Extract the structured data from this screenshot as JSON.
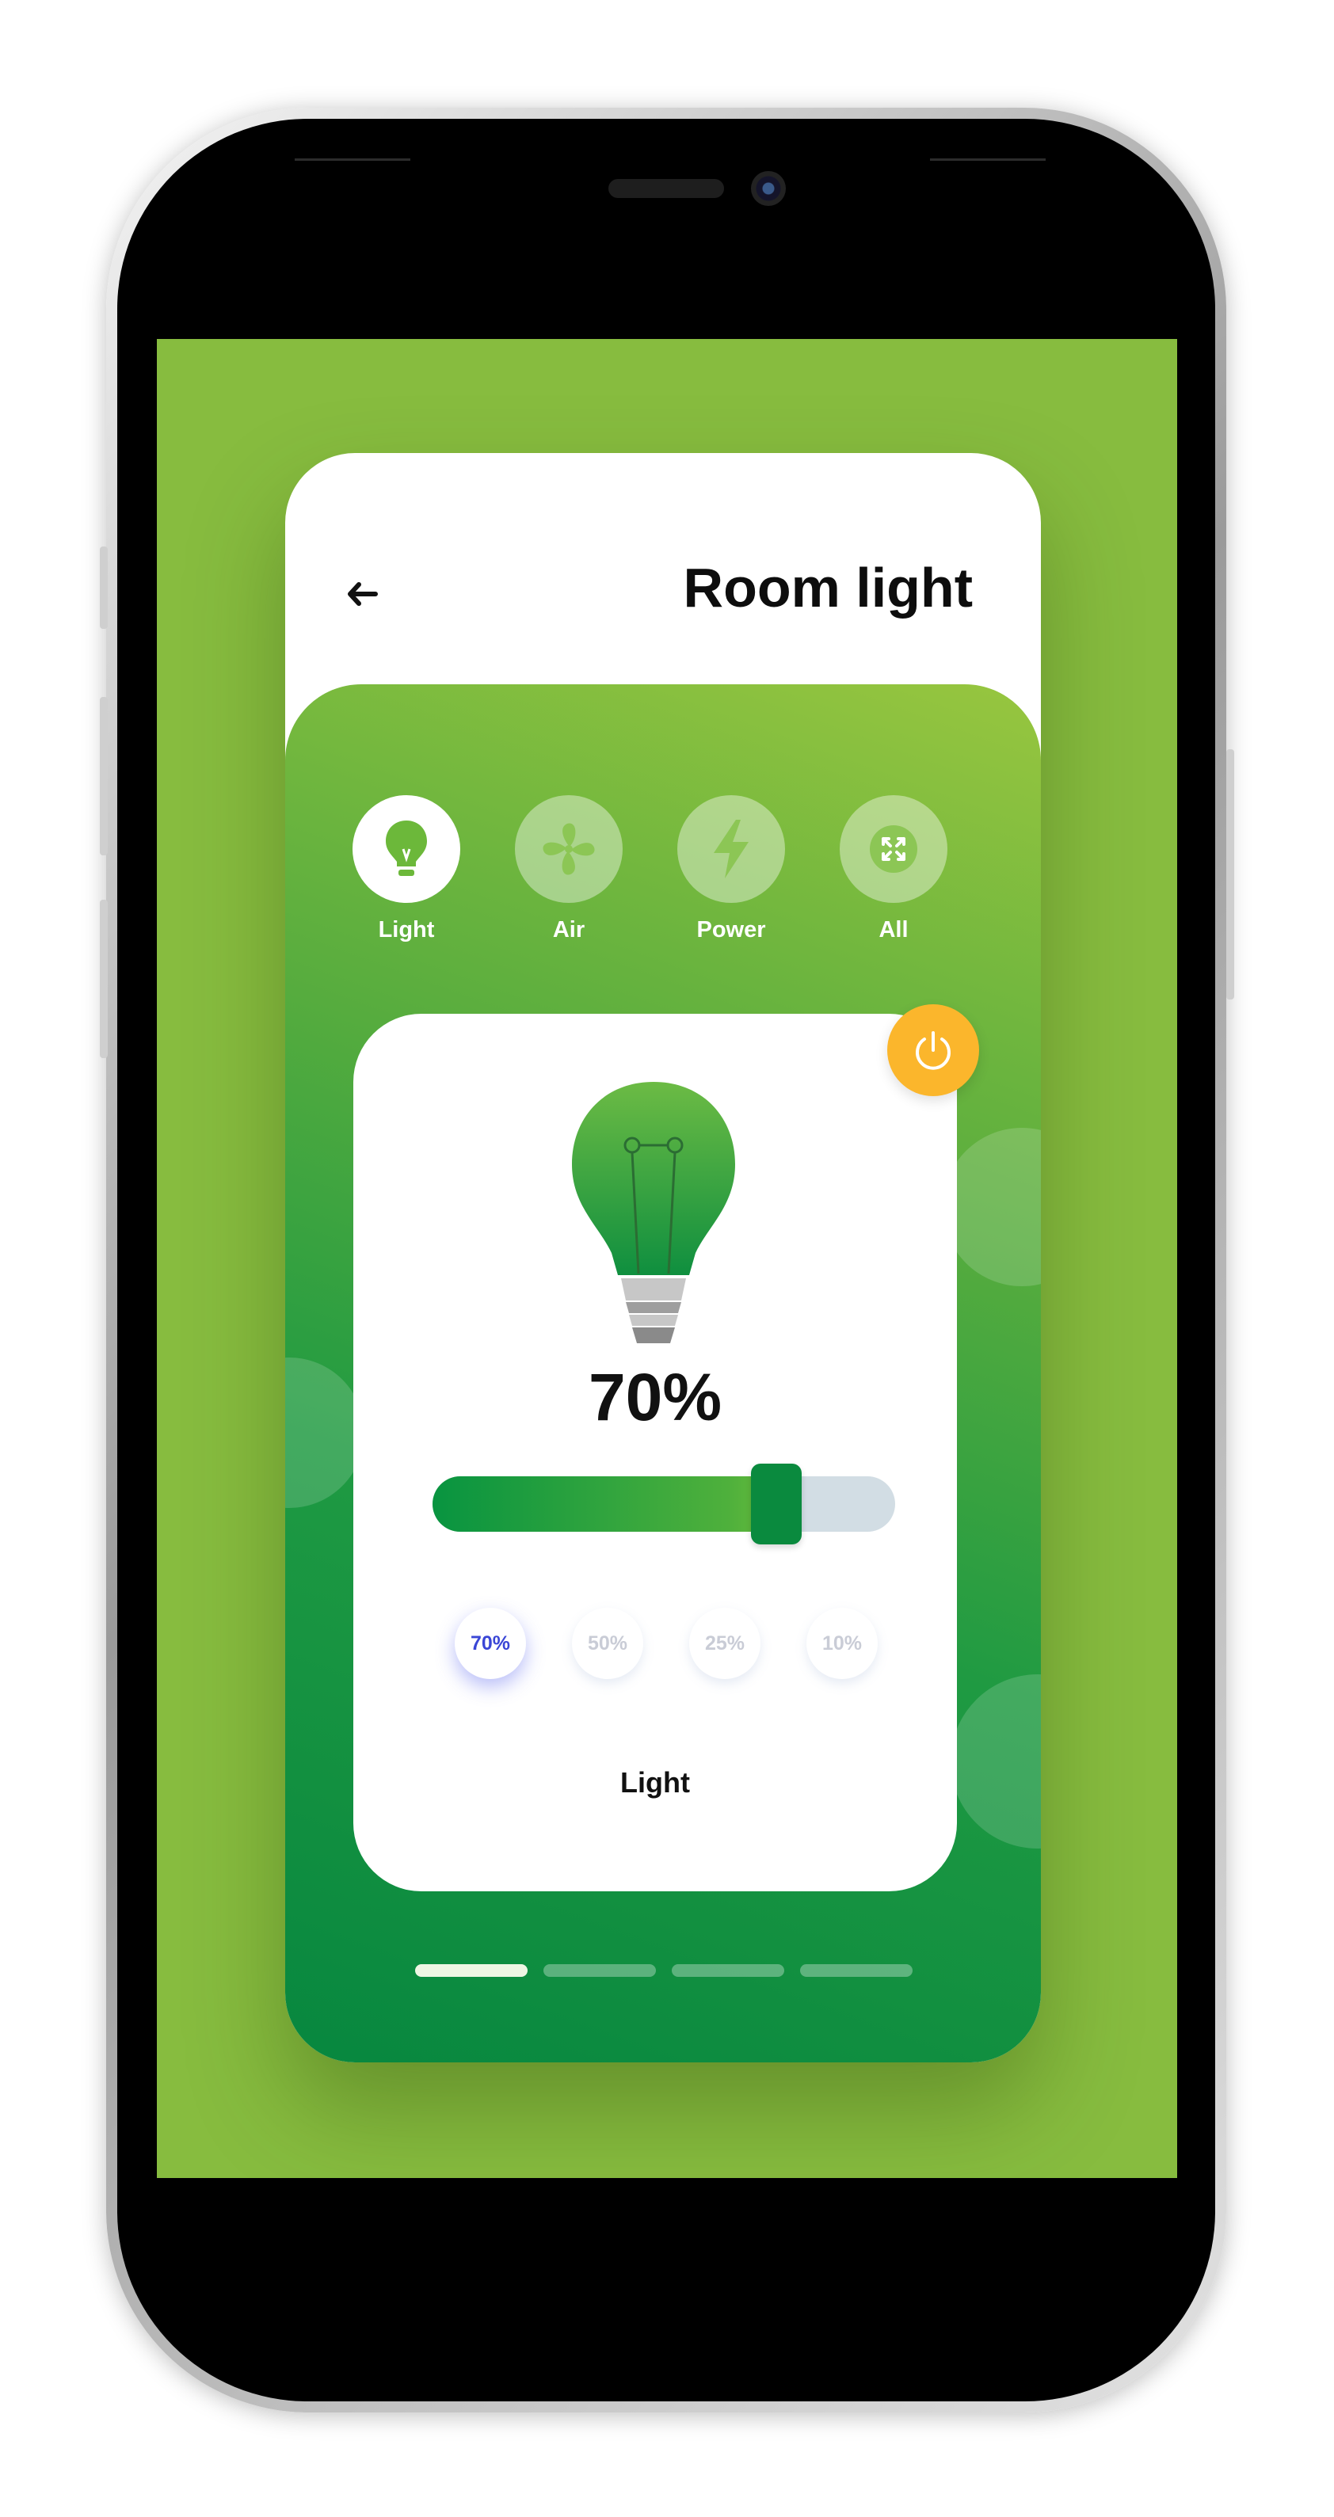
{
  "header": {
    "title": "Room light",
    "back_icon": "arrow-left-icon"
  },
  "categories": [
    {
      "label": "Light",
      "icon": "lightbulb-icon",
      "active": true
    },
    {
      "label": "Air",
      "icon": "fan-icon",
      "active": false
    },
    {
      "label": "Power",
      "icon": "lightning-bolt-icon",
      "active": false
    },
    {
      "label": "All",
      "icon": "expand-arrows-icon",
      "active": false
    }
  ],
  "control": {
    "level_text": "70%",
    "level_value": 0.75,
    "presets": [
      "70%",
      "50%",
      "25%",
      "10%"
    ],
    "active_preset": 0,
    "label": "Light",
    "power_icon": "power-icon"
  },
  "pager": {
    "count": 4,
    "active": 0
  },
  "colors": {
    "background": "#87bc3f",
    "accent": "#0a8a3e",
    "power": "#fbb62c",
    "preset_active": "#3a46d6"
  }
}
